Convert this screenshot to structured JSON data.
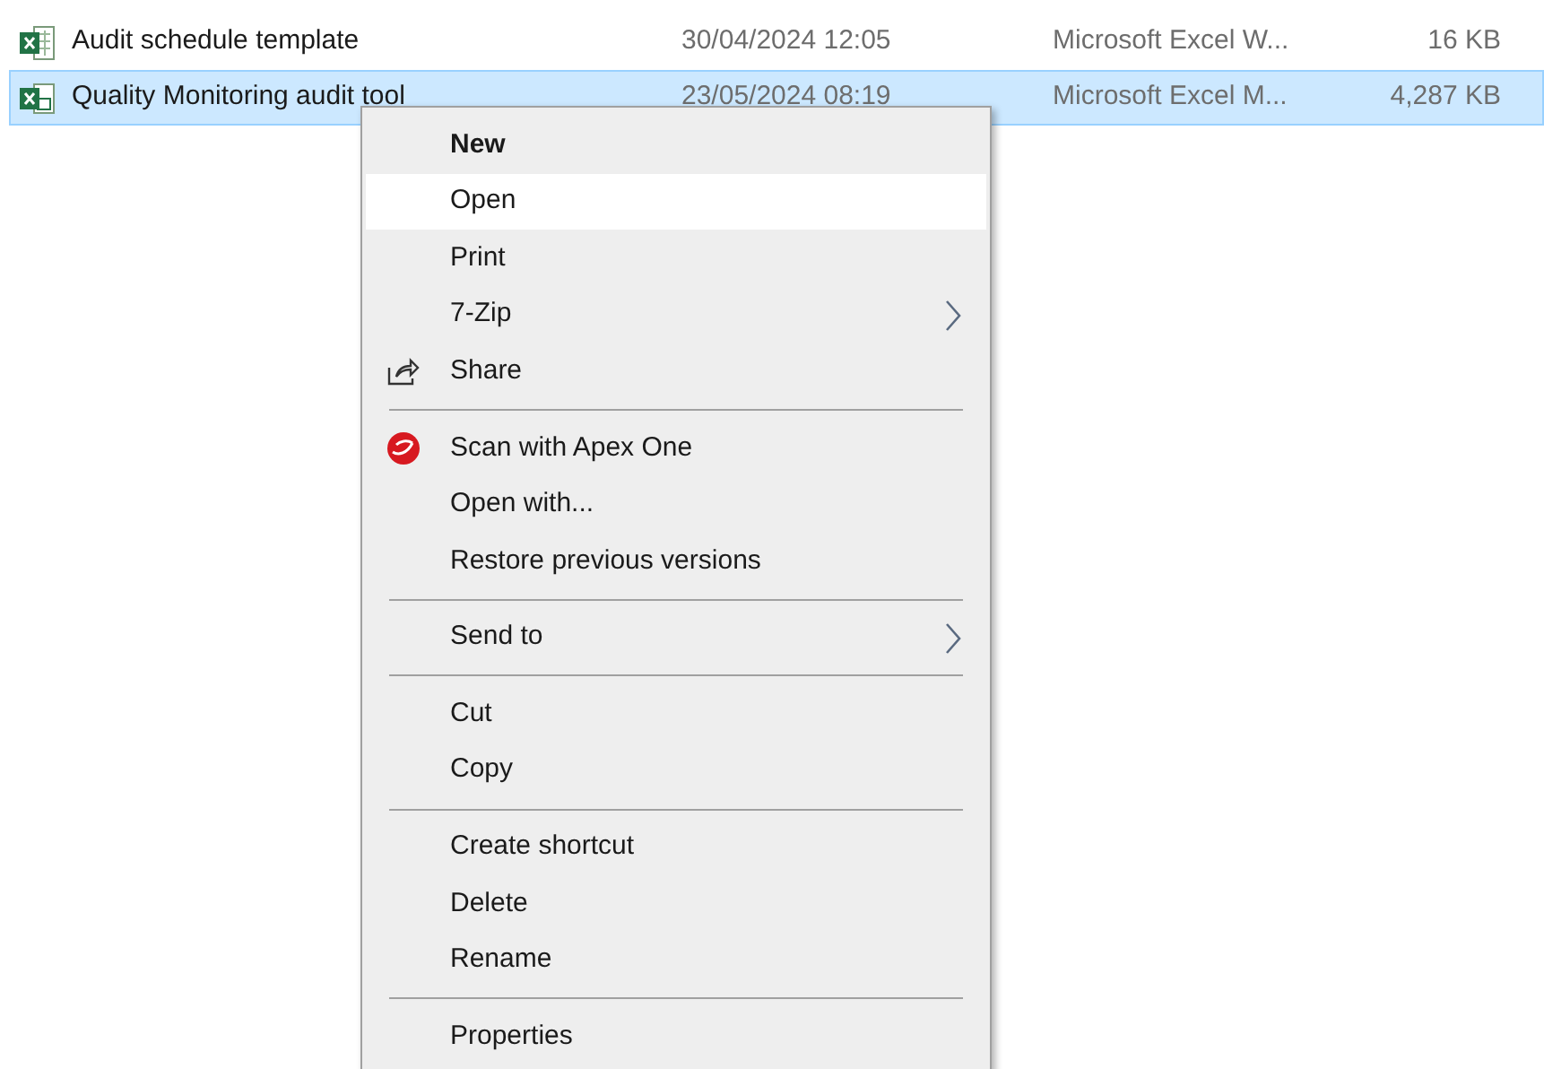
{
  "files": [
    {
      "name": "Audit schedule template",
      "modified": "30/04/2024 12:05",
      "type": "Microsoft Excel W...",
      "size": "16 KB",
      "selected": false,
      "kind": "workbook"
    },
    {
      "name": "Quality Monitoring audit tool",
      "modified": "23/05/2024 08:19",
      "type": "Microsoft Excel M...",
      "size": "4,287 KB",
      "selected": true,
      "kind": "macro"
    }
  ],
  "context_menu": [
    {
      "kind": "item",
      "label": "New",
      "bold": true,
      "highlighted": false,
      "submenu": false
    },
    {
      "kind": "item",
      "label": "Open",
      "bold": false,
      "highlighted": true,
      "submenu": false
    },
    {
      "kind": "item",
      "label": "Print",
      "bold": false,
      "highlighted": false,
      "submenu": false
    },
    {
      "kind": "item",
      "label": "7-Zip",
      "bold": false,
      "highlighted": false,
      "submenu": true
    },
    {
      "kind": "share",
      "label": "Share",
      "bold": false,
      "highlighted": false,
      "submenu": false
    },
    {
      "kind": "separator"
    },
    {
      "kind": "scan",
      "label": "Scan with Apex One",
      "bold": false,
      "highlighted": false,
      "submenu": false
    },
    {
      "kind": "item",
      "label": "Open with...",
      "bold": false,
      "highlighted": false,
      "submenu": false
    },
    {
      "kind": "item",
      "label": "Restore previous versions",
      "bold": false,
      "highlighted": false,
      "submenu": false
    },
    {
      "kind": "separator"
    },
    {
      "kind": "item",
      "label": "Send to",
      "bold": false,
      "highlighted": false,
      "submenu": true
    },
    {
      "kind": "separator"
    },
    {
      "kind": "item",
      "label": "Cut",
      "bold": false,
      "highlighted": false,
      "submenu": false
    },
    {
      "kind": "item",
      "label": "Copy",
      "bold": false,
      "highlighted": false,
      "submenu": false
    },
    {
      "kind": "separator"
    },
    {
      "kind": "item",
      "label": "Create shortcut",
      "bold": false,
      "highlighted": false,
      "submenu": false
    },
    {
      "kind": "item",
      "label": "Delete",
      "bold": false,
      "highlighted": false,
      "submenu": false
    },
    {
      "kind": "item",
      "label": "Rename",
      "bold": false,
      "highlighted": false,
      "submenu": false
    },
    {
      "kind": "separator"
    },
    {
      "kind": "item",
      "label": "Properties",
      "bold": false,
      "highlighted": false,
      "submenu": false
    }
  ]
}
